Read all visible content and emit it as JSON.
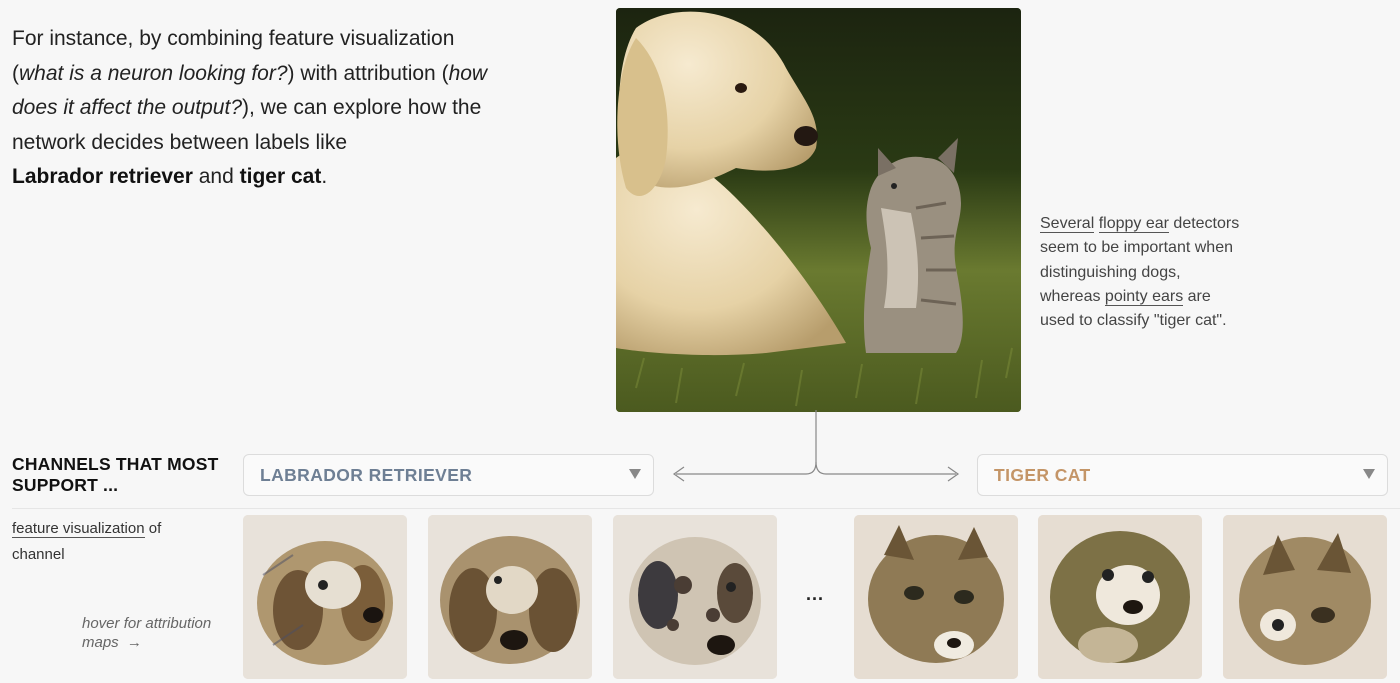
{
  "intro": {
    "line1": "For instance, by combining feature visualization",
    "line2_open": "(",
    "line2_q1": "what is a neuron looking for?",
    "line2_mid": ") with attribution (",
    "line2_q2a": "how",
    "line3_q2b": "does it affect the output?",
    "line3_rest": "), we can explore how the",
    "line4": "network decides between labels like",
    "label_a": "Labrador retriever",
    "and": " and ",
    "label_b": "tiger cat",
    "period": "."
  },
  "side_note": {
    "several": "Several",
    "floppy": "floppy ear",
    "text1": " detectors seem to be important when distinguishing dogs, whereas ",
    "pointy": "pointy ears",
    "text2": " are used to classify \"tiger cat\"."
  },
  "channels": {
    "title": "CHANNELS THAT MOST SUPPORT ...",
    "fv_link": "feature visualization",
    "fv_rest": " of channel",
    "hover_hint": "hover for attribution maps",
    "arrow": "→",
    "ellipsis": "..."
  },
  "dropdowns": {
    "left": {
      "selected": "LABRADOR RETRIEVER",
      "color": "#6e7f94"
    },
    "right": {
      "selected": "TIGER CAT",
      "color": "#c49567"
    }
  },
  "thumbnails": {
    "left_count": 3,
    "right_count": 3,
    "left_subject": "dog-feature-visualization",
    "right_subject": "cat-feature-visualization"
  },
  "colors": {
    "background": "#f7f7f7",
    "grass": "#4f5f23",
    "dog_accent": "#6e7f94",
    "cat_accent": "#c49567"
  }
}
